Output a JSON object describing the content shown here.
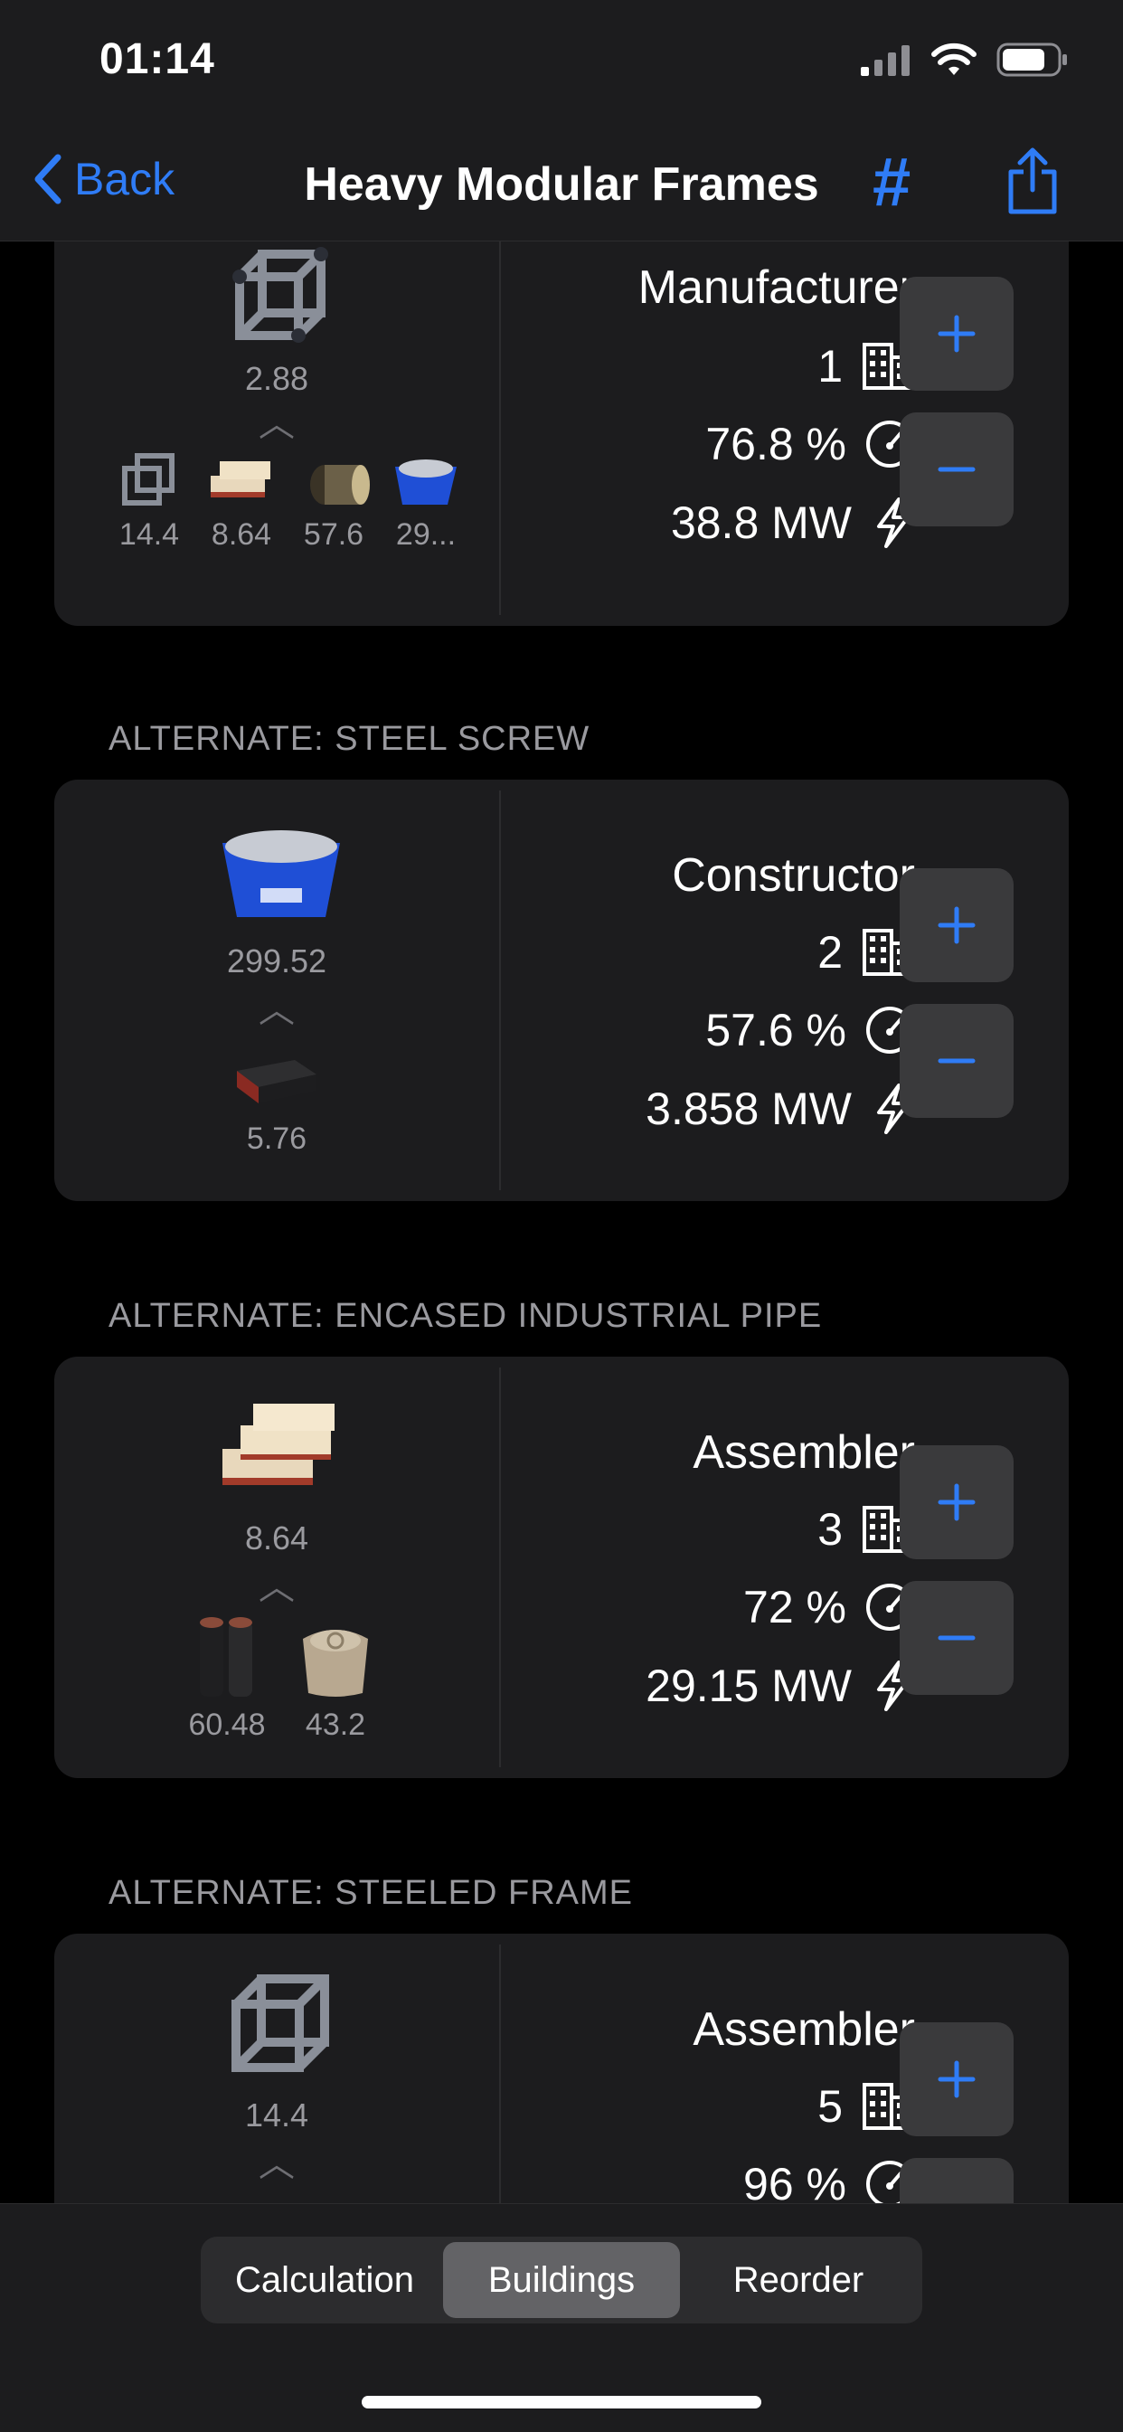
{
  "status": {
    "time": "01:14"
  },
  "nav": {
    "back_label": "Back",
    "title": "Heavy Modular Frames",
    "hash_label": "#"
  },
  "sections": [
    {
      "header": "",
      "main_qty": "2.88",
      "inputs": [
        "14.4",
        "8.64",
        "57.6",
        "29..."
      ],
      "building": "Manufacturer",
      "count": "1",
      "clock": "76.8 %",
      "power": "38.8 MW"
    },
    {
      "header": "ALTERNATE: STEEL SCREW",
      "main_qty": "299.52",
      "inputs": [
        "5.76"
      ],
      "building": "Constructor",
      "count": "2",
      "clock": "57.6 %",
      "power": "3.858 MW"
    },
    {
      "header": "ALTERNATE: ENCASED INDUSTRIAL PIPE",
      "main_qty": "8.64",
      "inputs": [
        "60.48",
        "43.2"
      ],
      "building": "Assembler",
      "count": "3",
      "clock": "72 %",
      "power": "29.15 MW"
    },
    {
      "header": "ALTERNATE: STEELED FRAME",
      "main_qty": "14.4",
      "inputs": [],
      "building": "Assembler",
      "count": "5",
      "clock": "96 %",
      "power": ""
    }
  ],
  "tabs": {
    "calculation": "Calculation",
    "buildings": "Buildings",
    "reorder": "Reorder",
    "active": "Buildings"
  },
  "colors": {
    "accent": "#2f7cf6",
    "card": "#1c1c1e",
    "button": "#3a3a3c"
  }
}
